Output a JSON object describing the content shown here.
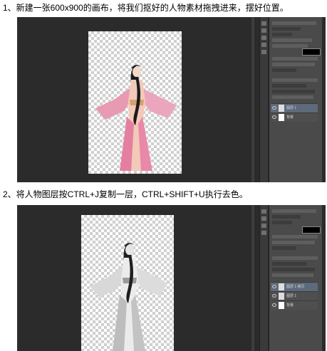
{
  "steps": [
    {
      "text": "1、新建一张600x900的画布，将我们抠好的人物素材拖拽进来，摆好位置。",
      "layers": [
        {
          "name": "图层 1",
          "selected": true,
          "thumb": "person"
        },
        {
          "name": "背景",
          "selected": false,
          "thumb": "white"
        }
      ]
    },
    {
      "text": "2、将人物图层按CTRL+J复制一层，CTRL+SHIFT+U执行去色。",
      "layers": [
        {
          "name": "图层 1 拷贝",
          "selected": true,
          "thumb": "person"
        },
        {
          "name": "图层 1",
          "selected": false,
          "thumb": "person"
        },
        {
          "name": "背景",
          "selected": false,
          "thumb": "white"
        }
      ]
    }
  ],
  "colors": {
    "workspace": "#2b2b2b",
    "panel": "#4a4a4a",
    "dress_color": "#e7a3b8",
    "dress_gray": "#c9c9c9"
  }
}
